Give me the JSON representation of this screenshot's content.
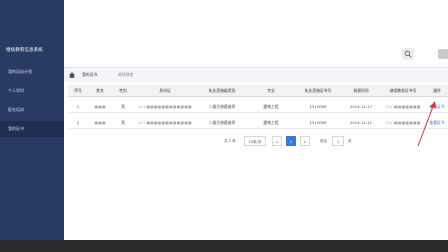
{
  "sidebar": {
    "title": "继续教育信息系统",
    "items": [
      {
        "label": "我的培训计划"
      },
      {
        "label": "个人学时"
      },
      {
        "label": "报名培训"
      },
      {
        "label": "我的证书"
      }
    ]
  },
  "topbar": {
    "button_icon": "search-icon"
  },
  "breadcrumb": {
    "active_tab": "我的证书",
    "other_tab": "继续教育"
  },
  "table": {
    "columns": [
      "序号",
      "姓名",
      "性别",
      "身份证",
      "执业资格级类别",
      "专业",
      "执业资格证书号",
      "授权时间",
      "继续教育证书号",
      "操作"
    ],
    "rows": [
      {
        "index": "1",
        "name": "■■■",
        "gender": "男",
        "id": "420■■■■■■■■■■■■",
        "category": "二级注册建造师",
        "major": "建筑工程",
        "cert_no": "1313009",
        "time": "2014-11-17",
        "ce_no": "H20■■■■■■■",
        "action": "查看证书"
      },
      {
        "index": "2",
        "name": "■■■",
        "gender": "男",
        "id": "421■■■■■■■■■■■■",
        "category": "二级注册建造师",
        "major": "建筑工程",
        "cert_no": "1313009",
        "time": "2014-11-11",
        "ce_no": "H20■■■■■■■",
        "action": "查看证书"
      }
    ]
  },
  "pager": {
    "total": "共 2 条",
    "page_size": "10条/页",
    "prev": "<",
    "current": "1",
    "next": ">",
    "goto_label": "前往",
    "goto_value": "1",
    "page_suffix": "页"
  },
  "colors": {
    "sidebar_bg": "#283b63",
    "accent": "#3a78d8",
    "annotation": "#e0322d"
  }
}
